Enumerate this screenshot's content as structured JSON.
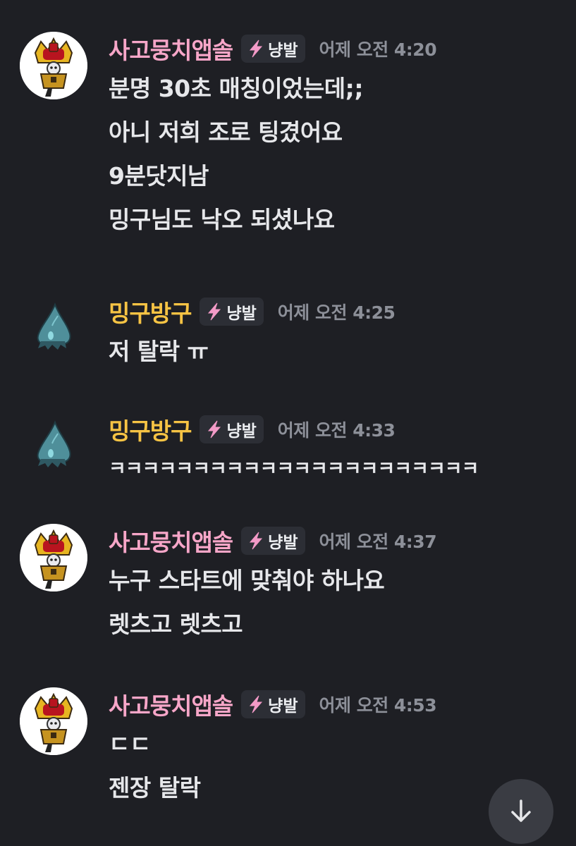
{
  "messages": [
    {
      "user": "사고뭉치앱솔",
      "tag": "냥발",
      "time": "어제 오전 4:20",
      "lines": [
        "분명 30초 매칭이었는데;;",
        "아니 저희 조로 팅겼어요",
        "9분닷지남",
        "밍구님도 낙오 되셨나요"
      ]
    },
    {
      "user": "밍구방구",
      "tag": "냥발",
      "time": "어제 오전 4:25",
      "lines": [
        "저 탈락 ㅠ"
      ]
    },
    {
      "user": "밍구방구",
      "tag": "냥발",
      "time": "어제 오전 4:33",
      "lines": [
        "ㅋㅋㅋㅋㅋㅋㅋㅋㅋㅋㅋㅋㅋㅋㅋㅋㅋㅋㅋㅋㅋㅋ"
      ]
    },
    {
      "user": "사고뭉치앱솔",
      "tag": "냥발",
      "time": "어제 오전 4:37",
      "lines": [
        "누구 스타트에 맞춰야 하나요",
        "렛츠고 렛츠고"
      ]
    },
    {
      "user": "사고뭉치앱솔",
      "tag": "냥발",
      "time": "어제 오전 4:53",
      "lines": [
        "ㄷㄷ",
        "젠장 탈락"
      ]
    }
  ],
  "icons": {
    "tag_icon": "lightning-bolt-icon",
    "scroll_button_icon": "arrow-down-icon"
  },
  "colors": {
    "background": "#1e1f24",
    "username_pink": "#f7a6c8",
    "username_gold": "#f6c344",
    "timestamp": "#8d9099",
    "tag_background": "#2c2e35",
    "scroll_button": "#3a3c43"
  }
}
